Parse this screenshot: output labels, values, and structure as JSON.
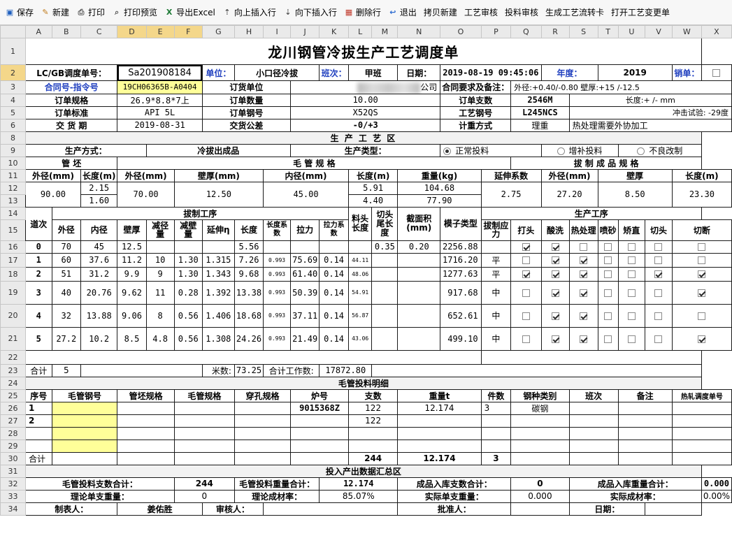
{
  "toolbar": [
    {
      "label": "保存",
      "icon": "save-icon",
      "glyph": "▣",
      "color": "#1f5fbf"
    },
    {
      "label": "新建",
      "icon": "new-icon",
      "glyph": "✎",
      "color": "#c07a1a"
    },
    {
      "label": "打印",
      "icon": "print-icon",
      "glyph": "⎙",
      "color": "#555"
    },
    {
      "label": "打印预览",
      "icon": "print-preview-icon",
      "glyph": "⌕",
      "color": "#555"
    },
    {
      "label": "导出Excel",
      "icon": "excel-icon",
      "glyph": "X",
      "color": "#1e7a36"
    },
    {
      "label": "向上插入行",
      "icon": "insert-row-above-icon",
      "glyph": "⇡",
      "color": "#555"
    },
    {
      "label": "向下插入行",
      "icon": "insert-row-below-icon",
      "glyph": "⇣",
      "color": "#555"
    },
    {
      "label": "删除行",
      "icon": "delete-row-icon",
      "glyph": "▦",
      "color": "#c0392b"
    },
    {
      "label": "退出",
      "icon": "exit-icon",
      "glyph": "↩",
      "color": "#2a6ad0"
    },
    {
      "label": "拷贝新建",
      "icon": "",
      "glyph": "",
      "color": "#000"
    },
    {
      "label": "工艺审核",
      "icon": "",
      "glyph": "",
      "color": "#000"
    },
    {
      "label": "投料审核",
      "icon": "",
      "glyph": "",
      "color": "#000"
    },
    {
      "label": "生成工艺流转卡",
      "icon": "",
      "glyph": "",
      "color": "#000"
    },
    {
      "label": "打开工艺变更单",
      "icon": "",
      "glyph": "",
      "color": "#000"
    }
  ],
  "cols": [
    "A",
    "B",
    "C",
    "D",
    "E",
    "F",
    "G",
    "H",
    "I",
    "J",
    "K",
    "L",
    "M",
    "N",
    "O",
    "P",
    "Q",
    "R",
    "S",
    "T",
    "U",
    "V",
    "W",
    "X"
  ],
  "title": "龙川钢管冷拔生产工艺调度单",
  "r2": {
    "std_label": "LC/GB调度单号：",
    "std_value": "Sa201908184",
    "unit_label": "单位：",
    "unit_value": "小口径冷拔",
    "shift_label": "班次：",
    "shift_value": "甲班",
    "date_label": "日期：",
    "date_value": "2019-08-19 09:45:06",
    "year_label": "年度：",
    "year_value": "2019",
    "cancel_label": "销单："
  },
  "r3": {
    "contract_label": "合同号-指令号",
    "contract_value": "19CH06365B-A0404",
    "customer_label": "订货单位",
    "customer_suffix": "公司",
    "req_label": "合同要求及备注：",
    "req_1": "外径:+0.40/-0.80  壁厚:+15 /-12.5",
    "req_2": "长度:+ /- mm",
    "req_3": "冲击试验: -29度",
    "req_4": "热处理需要外协加工"
  },
  "r4": {
    "spec_label": "订单规格",
    "spec_value": "26.9*8.8*7上",
    "qty_label": "订单数量",
    "qty_value": "10.00",
    "pcs_label": "订单支数",
    "pcs_value": "2546M"
  },
  "r5": {
    "std_label": "订单标准",
    "std_value": "API 5L",
    "steel_label": "订单钢号",
    "steel_value": "X52QS",
    "proc_label": "工艺钢号",
    "proc_value": "L245NCS"
  },
  "r6": {
    "due_label": "交 货 期",
    "due_value": "2019-08-31",
    "tol_label": "交货公差",
    "tol_value": "-0/+3",
    "meas_label": "计重方式",
    "meas_value": "理重"
  },
  "sec_prod": "生 产 工 艺 区",
  "r9": {
    "mode_label": "生产方式：",
    "mode_value": "冷拔出成品",
    "type_label": "生产类型：",
    "opt1": "正常投料",
    "opt2": "增补投料",
    "opt3": "不良改制"
  },
  "r10": {
    "pipe": "管 坯",
    "tube": "毛 管 规 格",
    "fin": "拔 制 成 品 规 格"
  },
  "r11": {
    "od": "外径(mm)",
    "len": "长度(m)",
    "tod": "外径(mm)",
    "twt": "壁厚(mm)",
    "tid": "内径(mm)",
    "tlen": "长度(m)",
    "twgt": "重量(kg)",
    "elong": "延伸系数",
    "fod": "外径(mm)",
    "fwt": "壁厚",
    "flen": "长度(m)"
  },
  "r12": {
    "od": "90.00",
    "len1": "2.15",
    "len2": "1.60",
    "tod": "70.00",
    "twt": "12.50",
    "tid": "45.00",
    "tlen1": "5.91",
    "tlen2": "4.40",
    "twgt1": "104.68",
    "twgt2": "77.90",
    "elong": "2.75",
    "fod": "27.20",
    "fwt": "8.50",
    "flen": "23.30"
  },
  "r14": {
    "pass": "道次",
    "draw": "拔制工序",
    "hc": "料头长度",
    "tc": "切头尾长度",
    "area": "截面积(mm)",
    "mold": "模子类型",
    "proc": "生产工序"
  },
  "r15": [
    "外径",
    "内径",
    "壁厚",
    "减径量",
    "减壁量",
    "延伸η",
    "长度",
    "长度系数",
    "拉力",
    "拉力系数",
    "拔制应力"
  ],
  "proc_heads": [
    "打头",
    "酸洗",
    "热处理",
    "喷砂",
    "矫直",
    "切头",
    "切断"
  ],
  "passes": [
    {
      "n": "0",
      "od": "70",
      "id": "45",
      "wt": "12.5",
      "dr": "",
      "dw": "",
      "el": "",
      "len": "5.56",
      "lc": "",
      "f": "",
      "fc": "",
      "st": "",
      "hc": "0.35",
      "tc": "0.20",
      "area": "2256.88",
      "mold": "",
      "chk": [
        true,
        true,
        false,
        false,
        false,
        false,
        false
      ]
    },
    {
      "n": "1",
      "od": "60",
      "id": "37.6",
      "wt": "11.2",
      "dr": "10",
      "dw": "1.30",
      "el": "1.315",
      "len": "7.26",
      "lc": "0.993",
      "f": "75.69",
      "fc": "0.14",
      "st": "44.11",
      "hc": "",
      "tc": "",
      "area": "1716.20",
      "mold": "平",
      "chk": [
        false,
        true,
        true,
        false,
        false,
        false,
        false
      ]
    },
    {
      "n": "2",
      "od": "51",
      "id": "31.2",
      "wt": "9.9",
      "dr": "9",
      "dw": "1.30",
      "el": "1.343",
      "len": "9.68",
      "lc": "0.993",
      "f": "61.40",
      "fc": "0.14",
      "st": "48.06",
      "hc": "",
      "tc": "",
      "area": "1277.63",
      "mold": "平",
      "chk": [
        true,
        true,
        true,
        false,
        false,
        true,
        true
      ]
    },
    {
      "n": "3",
      "od": "40",
      "id": "20.76",
      "wt": "9.62",
      "dr": "11",
      "dw": "0.28",
      "el": "1.392",
      "len": "13.38",
      "lc": "0.993",
      "f": "50.39",
      "fc": "0.14",
      "st": "54.91",
      "hc": "",
      "tc": "",
      "area": "917.68",
      "mold": "中",
      "chk": [
        false,
        true,
        true,
        false,
        false,
        false,
        true
      ]
    },
    {
      "n": "4",
      "od": "32",
      "id": "13.88",
      "wt": "9.06",
      "dr": "8",
      "dw": "0.56",
      "el": "1.406",
      "len": "18.68",
      "lc": "0.993",
      "f": "37.11",
      "fc": "0.14",
      "st": "56.87",
      "hc": "",
      "tc": "",
      "area": "652.61",
      "mold": "中",
      "chk": [
        false,
        true,
        true,
        false,
        false,
        false,
        false
      ]
    },
    {
      "n": "5",
      "od": "27.2",
      "id": "10.2",
      "wt": "8.5",
      "dr": "4.8",
      "dw": "0.56",
      "el": "1.308",
      "len": "24.26",
      "lc": "0.993",
      "f": "21.49",
      "fc": "0.14",
      "st": "43.06",
      "hc": "",
      "tc": "",
      "area": "499.10",
      "mold": "中",
      "chk": [
        false,
        true,
        true,
        false,
        false,
        false,
        true
      ]
    }
  ],
  "r23": {
    "label": "合计",
    "count": "5",
    "meters_label": "米数:",
    "meters": "73.25",
    "work_label": "合计工作数:",
    "work": "17872.80"
  },
  "sec_feed": "毛管投料明细",
  "feed_heads": {
    "no": "序号",
    "steel": "毛管钢号",
    "pipe": "管坯规格",
    "tube": "毛管规格",
    "pierce": "穿孔规格",
    "heat": "炉号",
    "pcs": "支数",
    "wgt": "重量t",
    "pieces": "件数",
    "type": "钢种类别",
    "shift": "班次",
    "note": "备注",
    "hot": "热轧调度单号"
  },
  "feed": [
    {
      "no": "1",
      "heat": "9015368Z",
      "pcs": "122",
      "wgt": "12.174",
      "pieces": "3",
      "type": "碳钢"
    },
    {
      "no": "2",
      "heat": "",
      "pcs": "122",
      "wgt": "",
      "pieces": "",
      "type": ""
    }
  ],
  "r30": {
    "label": "合计",
    "pcs": "244",
    "wgt": "12.174",
    "pieces": "3"
  },
  "sec_sum": "投入产出数据汇总区",
  "r32": {
    "l1": "毛管投料支数合计：",
    "v1": "244",
    "l2": "毛管投料重量合计：",
    "v2": "12.174",
    "l3": "成品入库支数合计：",
    "v3": "0",
    "l4": "成品入库重量合计：",
    "v4": "0.000"
  },
  "r33": {
    "l1": "理论单支重量：",
    "v1": "0",
    "l2": "理论成材率：",
    "v2": "85.07%",
    "l3": "实际单支重量：",
    "v3": "0.000",
    "l4": "实际成材率：",
    "v4": "0.00%"
  },
  "r34": {
    "maker_label": "制表人：",
    "maker": "姜佑胜",
    "review_label": "审核人：",
    "approve_label": "批准人：",
    "date_label": "日期："
  }
}
